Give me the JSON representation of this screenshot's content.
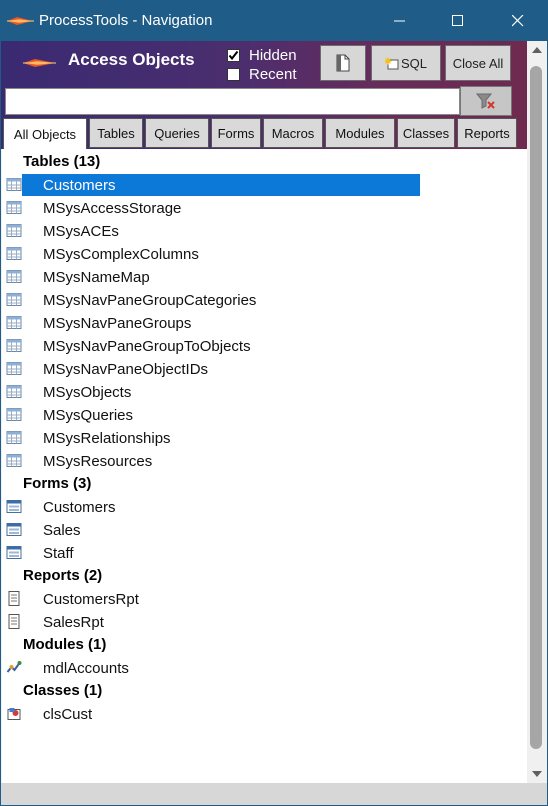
{
  "window": {
    "title": "ProcessTools - Navigation",
    "accent_color": "#1f5c87",
    "controls": [
      "minimize-icon",
      "maximize-icon",
      "close-icon"
    ]
  },
  "header": {
    "title": "Access Objects",
    "hidden_label": "Hidden",
    "hidden_checked": true,
    "recent_label": "Recent",
    "recent_checked": false,
    "sql_label": "SQL",
    "close_all_label": "Close All",
    "gradient_colors": [
      "#3a2a72",
      "#6e2a4e"
    ]
  },
  "search": {
    "value": "",
    "placeholder": ""
  },
  "tabs": [
    {
      "label": "All Objects",
      "active": true
    },
    {
      "label": "Tables",
      "active": false
    },
    {
      "label": "Queries",
      "active": false
    },
    {
      "label": "Forms",
      "active": false
    },
    {
      "label": "Macros",
      "active": false
    },
    {
      "label": "Modules",
      "active": false
    },
    {
      "label": "Classes",
      "active": false
    },
    {
      "label": "Reports",
      "active": false
    }
  ],
  "groups": [
    {
      "header": "Tables (13)",
      "icon": "table-icon",
      "items": [
        {
          "label": "Customers",
          "selected": true
        },
        {
          "label": "MSysAccessStorage"
        },
        {
          "label": "MSysACEs"
        },
        {
          "label": "MSysComplexColumns"
        },
        {
          "label": "MSysNameMap"
        },
        {
          "label": "MSysNavPaneGroupCategories"
        },
        {
          "label": "MSysNavPaneGroups"
        },
        {
          "label": "MSysNavPaneGroupToObjects"
        },
        {
          "label": "MSysNavPaneObjectIDs"
        },
        {
          "label": "MSysObjects"
        },
        {
          "label": "MSysQueries"
        },
        {
          "label": "MSysRelationships"
        },
        {
          "label": "MSysResources"
        }
      ]
    },
    {
      "header": "Forms (3)",
      "icon": "form-icon",
      "items": [
        {
          "label": "Customers"
        },
        {
          "label": "Sales"
        },
        {
          "label": "Staff"
        }
      ]
    },
    {
      "header": "Reports (2)",
      "icon": "report-icon",
      "items": [
        {
          "label": "CustomersRpt"
        },
        {
          "label": "SalesRpt"
        }
      ]
    },
    {
      "header": "Modules (1)",
      "icon": "module-icon",
      "items": [
        {
          "label": "mdlAccounts"
        }
      ]
    },
    {
      "header": "Classes (1)",
      "icon": "class-module-icon",
      "items": [
        {
          "label": "clsCust"
        }
      ]
    }
  ],
  "selection_color": "#0c78d7"
}
